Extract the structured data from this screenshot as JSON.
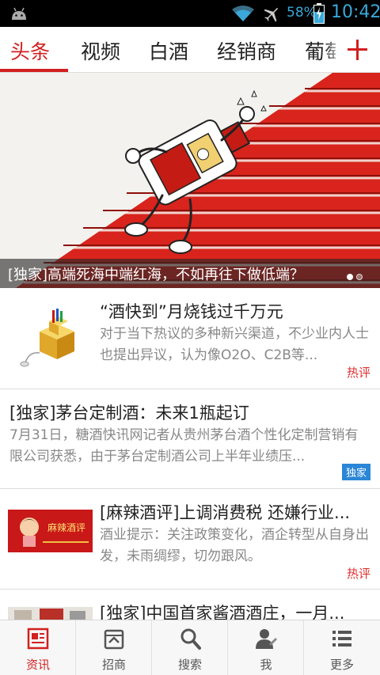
{
  "status_bar": {
    "battery_percent": "58%",
    "time": "10:42",
    "icons": [
      "android-icon",
      "wifi-icon",
      "airplane-mode-icon",
      "battery-charging-icon"
    ],
    "accent_color": "#3aa8d8"
  },
  "channels": {
    "active_index": 0,
    "items": [
      {
        "label": "头条"
      },
      {
        "label": "视频"
      },
      {
        "label": "白酒"
      },
      {
        "label": "经销商"
      },
      {
        "label": "葡萄"
      }
    ],
    "add_icon": "plus-icon",
    "accent_color": "#d22020"
  },
  "banner": {
    "caption": "[独家]高端死海中端红海，不如再往下做低端？",
    "page_count": 2,
    "active_page": 1
  },
  "news": [
    {
      "title": "“酒快到”月烧钱过千万元",
      "summary": "对于当下热议的多种新兴渠道，不少业内人士也提出异议，认为像O2O、C2B等...",
      "tag": "热评",
      "thumb": "gold-cubes-thumbnail"
    },
    {
      "title": "[独家]茅台定制酒：未来1瓶起订",
      "summary": "7月31日，糖酒快讯网记者从贵州茅台酒个性化定制营销有限公司获悉，由于茅台定制酒公司上半年业绩压...",
      "tag": "独家"
    },
    {
      "title": "[麻辣酒评]上调消费税 还嫌行业...",
      "summary": "酒业提示：关注政策变化，酒企转型从自身出发，未雨绸缪，切勿跟风。",
      "tag": "热评",
      "thumb": "mala-jiuping-thumbnail",
      "thumb_text": "麻辣酒评"
    },
    {
      "title": "[独家]中国首家酱酒酒庄，一月...",
      "thumb": "winery-photo-thumbnail"
    }
  ],
  "bottom_nav": {
    "active_index": 0,
    "items": [
      {
        "label": "资讯",
        "icon": "news-icon"
      },
      {
        "label": "招商",
        "icon": "investment-icon"
      },
      {
        "label": "搜索",
        "icon": "search-icon"
      },
      {
        "label": "我",
        "icon": "user-icon"
      },
      {
        "label": "更多",
        "icon": "more-list-icon"
      }
    ]
  }
}
